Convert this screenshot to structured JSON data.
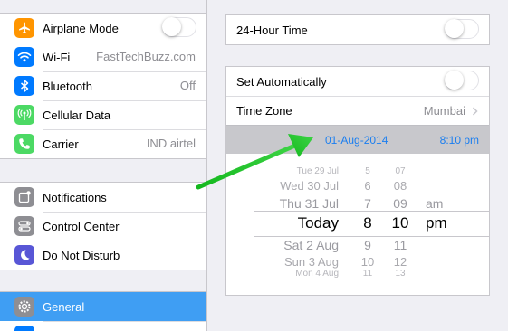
{
  "sidebar": {
    "group1": [
      {
        "label": "Airplane Mode",
        "icon": "airplane-icon",
        "color": "#ff9500",
        "control": "toggle"
      },
      {
        "label": "Wi-Fi",
        "icon": "wifi-icon",
        "color": "#007aff",
        "value": "FastTechBuzz.com"
      },
      {
        "label": "Bluetooth",
        "icon": "bluetooth-icon",
        "color": "#007aff",
        "value": "Off"
      },
      {
        "label": "Cellular Data",
        "icon": "cellular-icon",
        "color": "#4cd964"
      },
      {
        "label": "Carrier",
        "icon": "phone-icon",
        "color": "#4cd964",
        "value": "IND airtel"
      }
    ],
    "group2": [
      {
        "label": "Notifications",
        "icon": "notifications-icon",
        "color": "#8e8e93"
      },
      {
        "label": "Control Center",
        "icon": "control-center-icon",
        "color": "#8e8e93"
      },
      {
        "label": "Do Not Disturb",
        "icon": "moon-icon",
        "color": "#5856d6"
      }
    ],
    "group3": [
      {
        "label": "General",
        "icon": "gear-icon",
        "color": "#8e8e93",
        "selected": true
      }
    ]
  },
  "settings": {
    "hour24_label": "24-Hour Time",
    "set_auto_label": "Set Automatically",
    "timezone_label": "Time Zone",
    "timezone_value": "Mumbai",
    "selected_date": "01-Aug-2014",
    "selected_time": "8:10 pm"
  },
  "picker": {
    "days": [
      "Tue 29 Jul",
      "Wed 30 Jul",
      "Thu 31 Jul",
      "Today",
      "Sat 2 Aug",
      "Sun 3 Aug",
      "Mon 4 Aug"
    ],
    "hours": [
      "5",
      "6",
      "7",
      "8",
      "9",
      "10",
      "11"
    ],
    "minutes": [
      "07",
      "08",
      "09",
      "10",
      "11",
      "12",
      "13"
    ],
    "ampm": [
      "am",
      "pm"
    ]
  },
  "colors": {
    "accent": "#1a7ef0",
    "selected_row": "#3f9ef3",
    "arrow": "#1fc42a"
  }
}
